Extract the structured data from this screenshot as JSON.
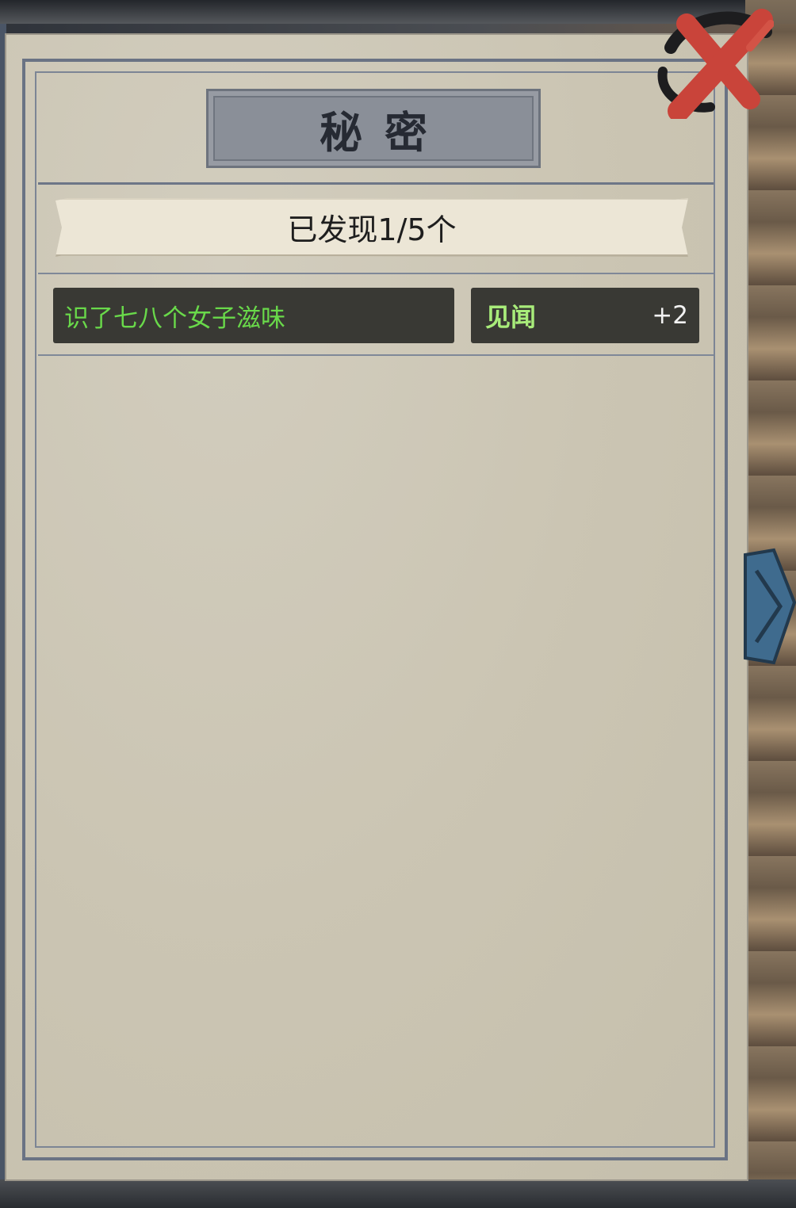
{
  "panel": {
    "title": "秘密",
    "discovered_label": "已发现1/5个"
  },
  "secrets": [
    {
      "name": "识了七八个女子滋味",
      "reward_type": "见闻",
      "reward_value": "+2"
    }
  ],
  "icons": {
    "close": "close-x-icon",
    "side_tab": "chevron-right-icon"
  },
  "colors": {
    "paper": "#cbc5b3",
    "frame": "#6a7384",
    "row_bg": "#393934",
    "secret_name": "#69d94a",
    "reward_label": "#a8ec7a",
    "close_red": "#c9443a",
    "tab_blue": "#3f6b8e"
  }
}
